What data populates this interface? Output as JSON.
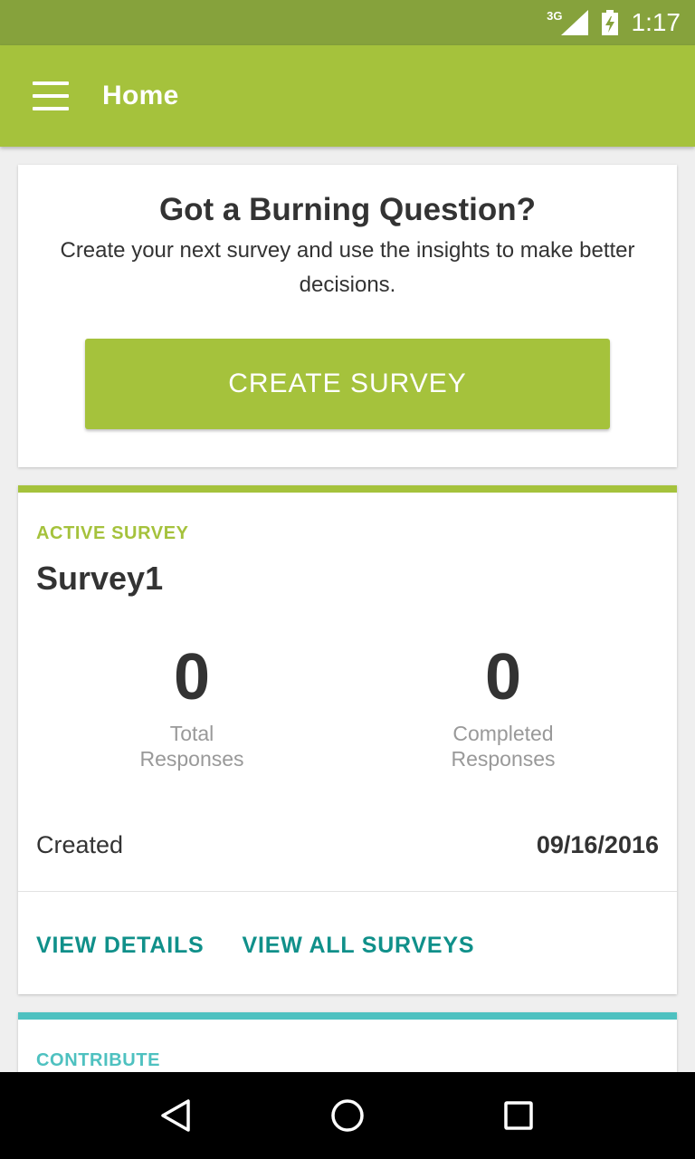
{
  "status_bar": {
    "network": "3G",
    "time": "1:17",
    "icons": [
      "signal-icon",
      "battery-icon"
    ]
  },
  "app_bar": {
    "title": "Home",
    "menu_icon": "hamburger-menu-icon"
  },
  "hero": {
    "title": "Got a Burning Question?",
    "text": "Create your next survey and use the insights to make better decisions.",
    "button_label": "CREATE SURVEY"
  },
  "survey": {
    "kicker": "ACTIVE SURVEY",
    "name": "Survey1",
    "total_value": "0",
    "total_label_line1": "Total",
    "total_label_line2": "Responses",
    "completed_value": "0",
    "completed_label_line1": "Completed",
    "completed_label_line2": "Responses",
    "created_label": "Created",
    "created_date": "09/16/2016",
    "view_details": "VIEW DETAILS",
    "view_all": "VIEW ALL SURVEYS"
  },
  "contribute": {
    "kicker": "CONTRIBUTE"
  },
  "nav": {
    "icons": [
      "back-icon",
      "home-icon",
      "recents-icon"
    ]
  },
  "colors": {
    "status_bar": "#86a23c",
    "primary": "#a5c23c",
    "link": "#10908a",
    "accent_teal": "#4ec1c0"
  }
}
